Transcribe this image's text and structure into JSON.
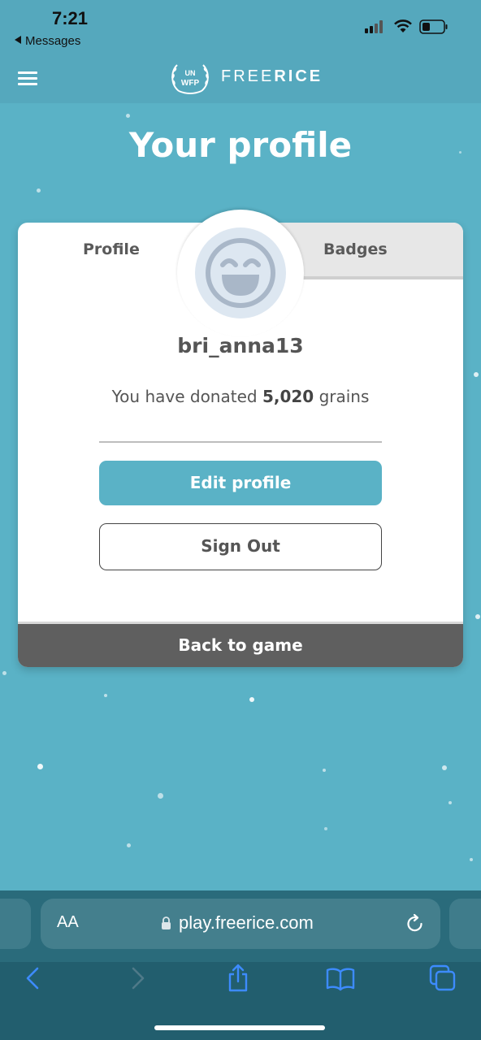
{
  "status_bar": {
    "time": "7:21",
    "back_label": "Messages"
  },
  "header": {
    "logo_badge": "UN WFP",
    "brand_light": "FREE",
    "brand_bold": "RICE"
  },
  "page": {
    "title": "Your profile"
  },
  "tabs": [
    {
      "label": "Profile",
      "active": true
    },
    {
      "label": "Badges",
      "active": false
    }
  ],
  "profile": {
    "username": "bri_anna13",
    "donated_prefix": "You have donated",
    "donated_amount": "5,020",
    "donated_suffix": "grains",
    "edit_label": "Edit profile",
    "signout_label": "Sign Out",
    "back_label": "Back to game"
  },
  "browser": {
    "text_size_label": "AA",
    "url": "play.freerice.com"
  },
  "colors": {
    "accent": "#5ab2c6",
    "header": "#55a8bd",
    "dark_button": "#5f5f5f",
    "browser_bg": "#225e6e",
    "ios_blue": "#3d8bff"
  }
}
